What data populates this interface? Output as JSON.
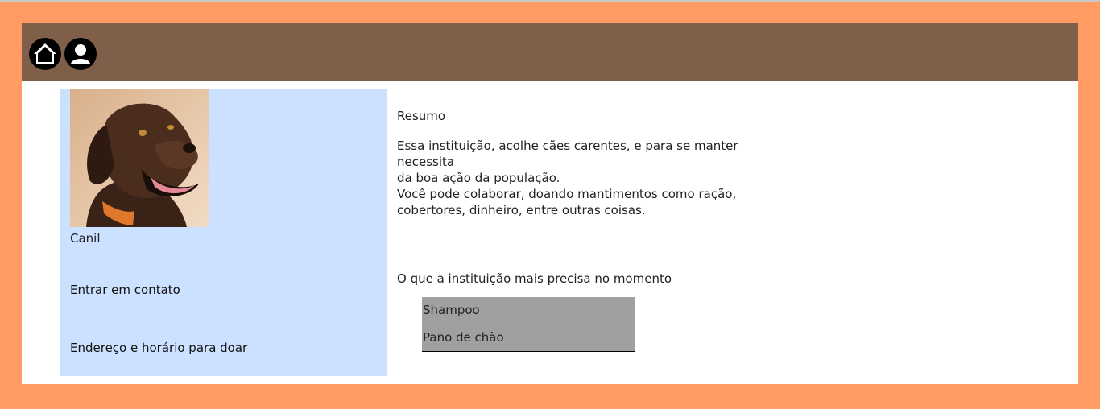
{
  "header": {
    "home_icon": "home-icon",
    "user_icon": "user-icon",
    "bar_color": "#7F5E4A"
  },
  "card": {
    "image_subject": "dog-photo",
    "title": "Canil",
    "contact_link": "Entrar em contato",
    "address_link": "Endereço e horário para doar",
    "background": "#CCE0FF"
  },
  "summary": {
    "title": "Resumo",
    "line1": "Essa instituição, acolhe cães carentes, e para se manter necessita",
    "line2": "da boa ação da população.",
    "line3": "Você pode colaborar, doando mantimentos como ração,",
    "line4": "cobertores, dinheiro, entre outras coisas."
  },
  "needs": {
    "title": "O que a instituição mais precisa no momento",
    "items": [
      "Shampoo",
      "Pano de chão"
    ]
  },
  "colors": {
    "page_background": "#FF9B63",
    "list_item_background": "#A0A0A0"
  }
}
